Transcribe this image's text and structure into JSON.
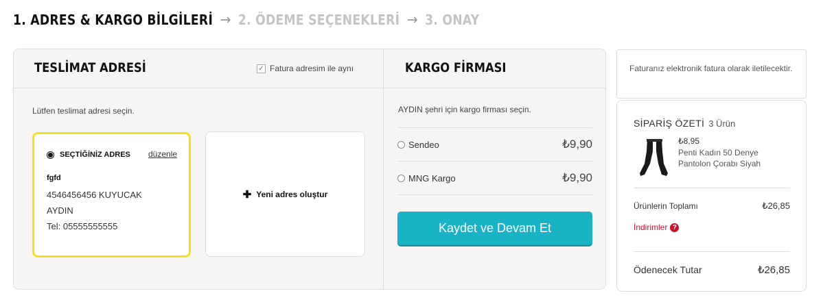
{
  "steps": {
    "step1": "1. ADRES & KARGO BİLGİLERİ",
    "step2": "2. ÖDEME SEÇENEKLERİ",
    "step3": "3. ONAY",
    "arrow": "→"
  },
  "delivery": {
    "title": "TESLİMAT ADRESİ",
    "same_billing_label": "Fatura adresim ile aynı",
    "same_billing_checked": true,
    "hint": "Lütfen teslimat adresi seçin.",
    "selected_card": {
      "selected_label": "SEÇTİĞİNİZ ADRES",
      "edit_label": "düzenle",
      "name": "fgfd",
      "line1": "4546456456 KUYUCAK",
      "line2": "AYDIN",
      "phone": "Tel: 05555555555"
    },
    "new_address_label": "Yeni adres oluştur",
    "accent_color": "#f3df1f"
  },
  "cargo": {
    "title": "KARGO FİRMASI",
    "hint": "AYDIN şehri için kargo firması seçin.",
    "options": [
      {
        "name": "Sendeo",
        "price": "₺9,90"
      },
      {
        "name": "MNG Kargo",
        "price": "₺9,90"
      }
    ],
    "continue_label": "Kaydet ve Devam Et",
    "button_color": "#1ab3c6"
  },
  "einvoice": {
    "text": "Faturanız elektronik fatura olarak iletilecektir."
  },
  "summary": {
    "title": "SİPARİŞ ÖZETİ",
    "count": "3 Ürün",
    "product": {
      "price": "₺8,95",
      "name": "Penti Kadın 50 Denye Pantolon Çorabı Siyah"
    },
    "subtotal_label": "Ürünlerin Toplamı",
    "subtotal_value": "₺26,85",
    "discounts_label": "İndirimler",
    "total_label": "Ödenecek Tutar",
    "total_value": "₺26,85",
    "discount_color": "#c8102e"
  }
}
